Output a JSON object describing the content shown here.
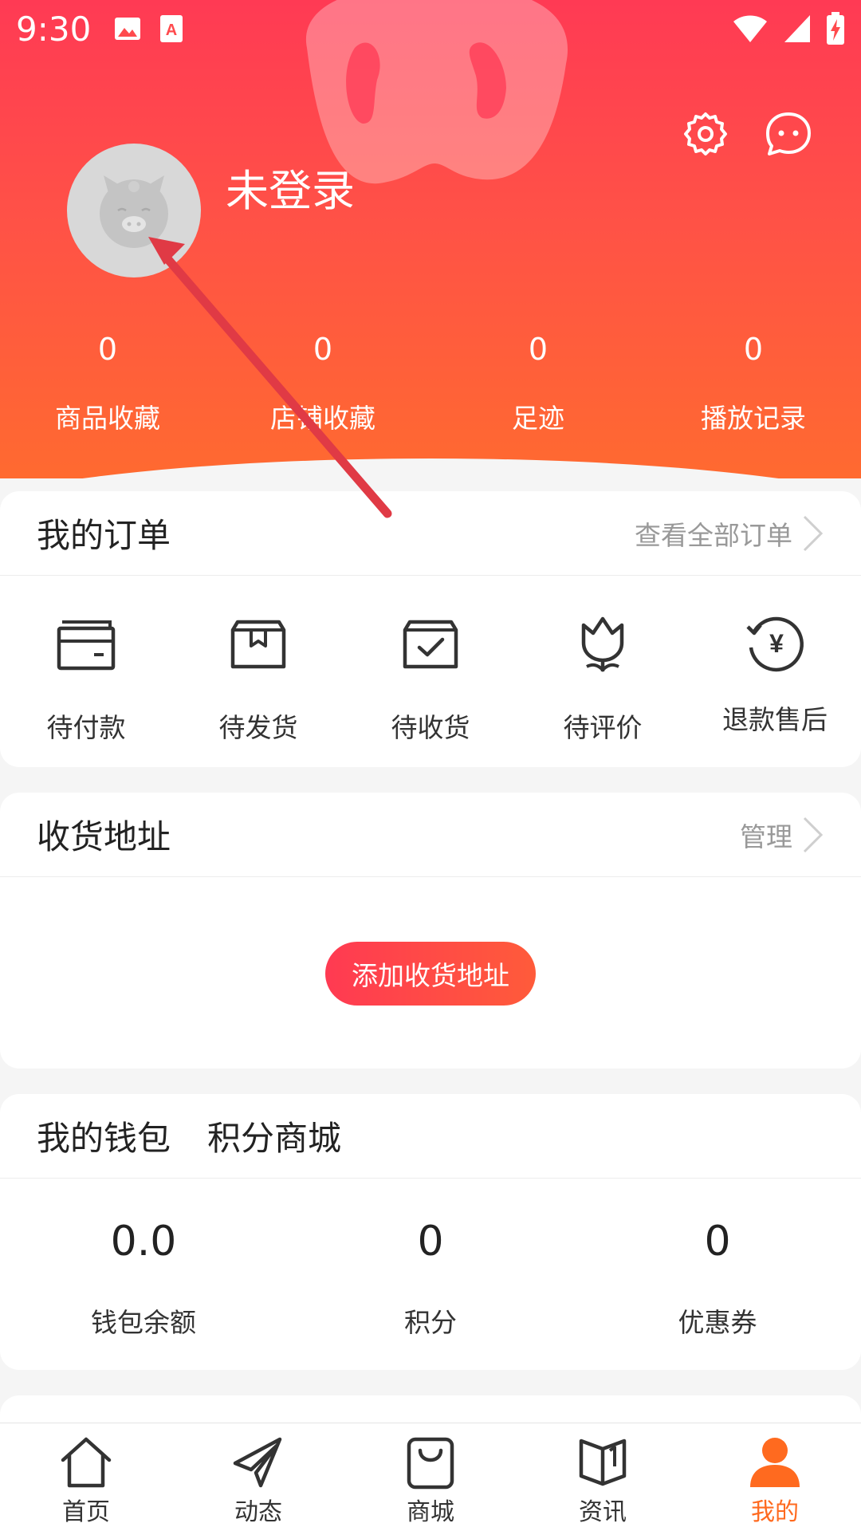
{
  "status_bar": {
    "time": "9:30"
  },
  "profile": {
    "login_text": "未登录"
  },
  "stats": [
    {
      "value": "0",
      "label": "商品收藏"
    },
    {
      "value": "0",
      "label": "店铺收藏"
    },
    {
      "value": "0",
      "label": "足迹"
    },
    {
      "value": "0",
      "label": "播放记录"
    }
  ],
  "orders": {
    "title": "我的订单",
    "more": "查看全部订单",
    "items": [
      {
        "label": "待付款",
        "icon": "wallet-icon"
      },
      {
        "label": "待发货",
        "icon": "box-icon"
      },
      {
        "label": "待收货",
        "icon": "box-check-icon"
      },
      {
        "label": "待评价",
        "icon": "tulip-icon"
      },
      {
        "label": "退款售后",
        "icon": "refund-icon"
      }
    ]
  },
  "address": {
    "title": "收货地址",
    "more": "管理",
    "add_button": "添加收货地址"
  },
  "wallet": {
    "title": "我的钱包",
    "title2": "积分商城",
    "items": [
      {
        "value": "0.0",
        "label": "钱包余额"
      },
      {
        "value": "0",
        "label": "积分"
      },
      {
        "value": "0",
        "label": "优惠券"
      }
    ]
  },
  "nav": [
    {
      "label": "首页",
      "icon": "home-icon"
    },
    {
      "label": "动态",
      "icon": "paper-plane-icon"
    },
    {
      "label": "商城",
      "icon": "shopping-bag-icon"
    },
    {
      "label": "资讯",
      "icon": "book-icon"
    },
    {
      "label": "我的",
      "icon": "user-icon",
      "active": true
    }
  ],
  "colors": {
    "primary": "#ff3a54",
    "accent": "#ff6a1f",
    "background": "#f5f5f5"
  }
}
